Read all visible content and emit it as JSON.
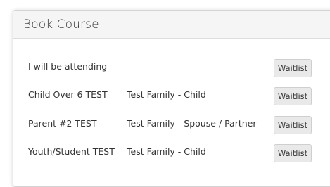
{
  "panel": {
    "title": "Book Course"
  },
  "attendees": [
    {
      "name": "I will be attending",
      "relation": "",
      "action_label": "Waitlist"
    },
    {
      "name": "Child Over 6 TEST",
      "relation": "Test Family - Child",
      "action_label": "Waitlist"
    },
    {
      "name": "Parent #2 TEST",
      "relation": "Test Family - Spouse / Partner",
      "action_label": "Waitlist"
    },
    {
      "name": "Youth/Student TEST",
      "relation": "Test Family - Child",
      "action_label": "Waitlist"
    }
  ]
}
